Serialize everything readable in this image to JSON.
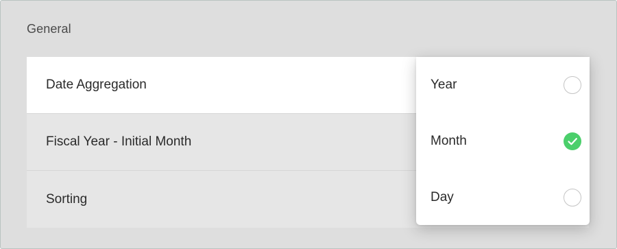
{
  "section": {
    "title": "General"
  },
  "settings": [
    {
      "label": "Date Aggregation",
      "active": true
    },
    {
      "label": "Fiscal Year - Initial Month",
      "active": false
    },
    {
      "label": "Sorting",
      "active": false
    }
  ],
  "dropdown": {
    "options": [
      {
        "label": "Year",
        "selected": false
      },
      {
        "label": "Month",
        "selected": true
      },
      {
        "label": "Day",
        "selected": false
      }
    ],
    "checked_color": "#4bcf6b"
  }
}
